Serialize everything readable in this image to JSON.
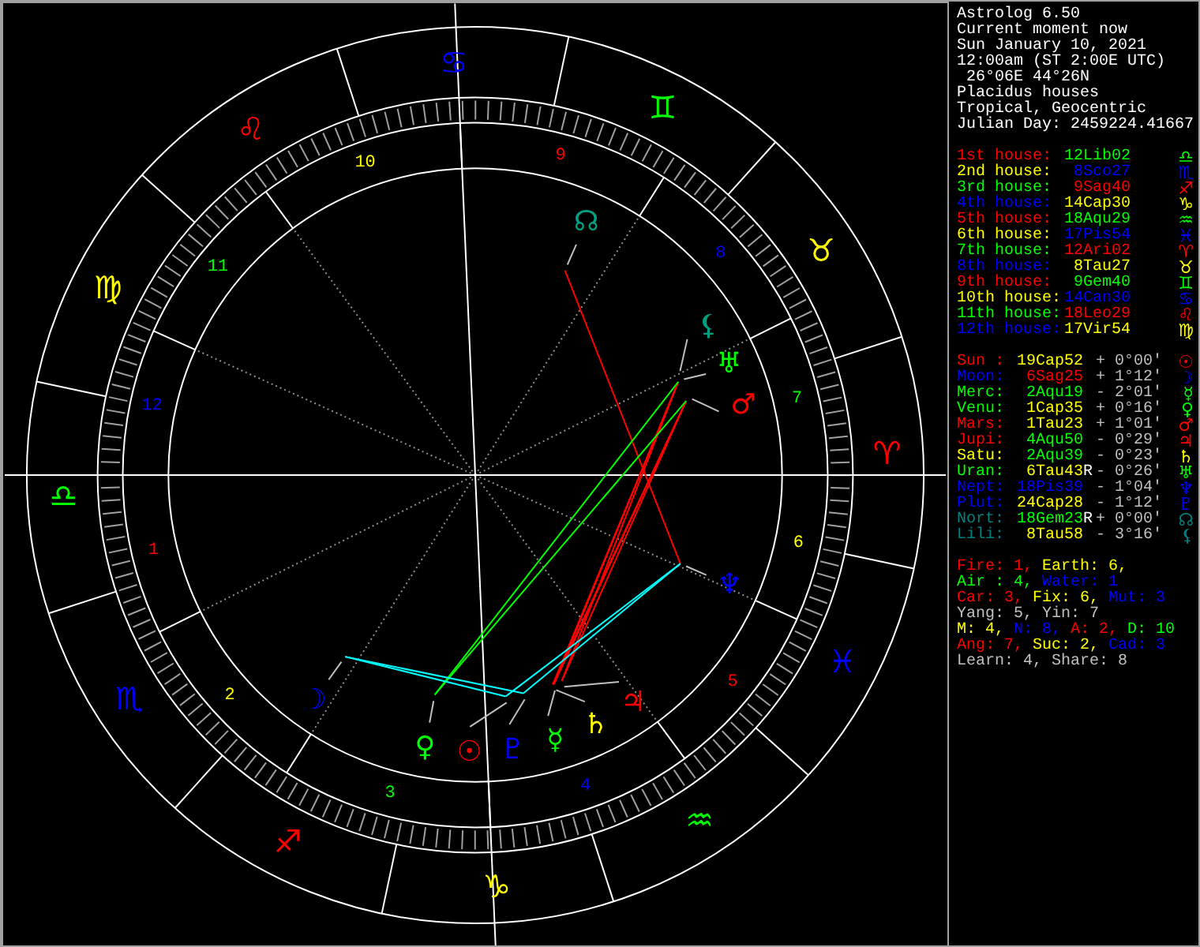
{
  "wheel": {
    "signs": [
      {
        "glyph": "♈",
        "color": "#ff0000"
      },
      {
        "glyph": "♉",
        "color": "#ffff00"
      },
      {
        "glyph": "♊",
        "color": "#00ff00"
      },
      {
        "glyph": "♋",
        "color": "#0000ff"
      },
      {
        "glyph": "♌",
        "color": "#ff0000"
      },
      {
        "glyph": "♍",
        "color": "#ffff00"
      },
      {
        "glyph": "♎",
        "color": "#00ff00"
      },
      {
        "glyph": "♏",
        "color": "#0000ff"
      },
      {
        "glyph": "♐",
        "color": "#ff0000"
      },
      {
        "glyph": "♑",
        "color": "#ffff00"
      },
      {
        "glyph": "♒",
        "color": "#00ff00"
      },
      {
        "glyph": "♓",
        "color": "#0000ff"
      }
    ],
    "houses": [
      {
        "number": "1",
        "color": "#ff0000"
      },
      {
        "number": "2",
        "color": "#ffff00"
      },
      {
        "number": "3",
        "color": "#00ff00"
      },
      {
        "number": "4",
        "color": "#0000ff"
      },
      {
        "number": "5",
        "color": "#ff0000"
      },
      {
        "number": "6",
        "color": "#ffff00"
      },
      {
        "number": "7",
        "color": "#00ff00"
      },
      {
        "number": "8",
        "color": "#0000ff"
      },
      {
        "number": "9",
        "color": "#ff0000"
      },
      {
        "number": "10",
        "color": "#ffff00"
      },
      {
        "number": "11",
        "color": "#00ff00"
      },
      {
        "number": "12",
        "color": "#0000ff"
      }
    ],
    "planets": [
      {
        "glyph": "☊",
        "color": "#00a080"
      },
      {
        "glyph": "⚸",
        "color": "#00a080"
      },
      {
        "glyph": "♅",
        "color": "#00ff00"
      },
      {
        "glyph": "♂",
        "color": "#ff0000"
      },
      {
        "glyph": "♆",
        "color": "#0000ff"
      },
      {
        "glyph": "☽",
        "color": "#0000ff"
      },
      {
        "glyph": "♃",
        "color": "#ff0000"
      },
      {
        "glyph": "♄",
        "color": "#ffff00"
      },
      {
        "glyph": "♀",
        "color": "#00ff00"
      },
      {
        "glyph": "☉",
        "color": "#ff0000"
      },
      {
        "glyph": "♇",
        "color": "#0000ff"
      },
      {
        "glyph": "☿",
        "color": "#00ff00"
      }
    ]
  },
  "info": [
    "Astrolog 6.50",
    "Current moment now",
    "Sun January 10, 2021",
    "12:00am (ST 2:00E UTC)",
    " 26°06E 44°26N",
    "Placidus houses",
    "Tropical, Geocentric",
    "Julian Day: 2459224.41667"
  ],
  "house_cusps": [
    {
      "label": {
        "text": "1st house:",
        "color": "#ff0000"
      },
      "position": {
        "text": "12Lib02",
        "color": "#00ff00"
      },
      "glyph": "♎"
    },
    {
      "label": {
        "text": "2nd house:",
        "color": "#ffff00"
      },
      "position": {
        "text": "8Sco27",
        "color": "#0000ff"
      },
      "glyph": "♏"
    },
    {
      "label": {
        "text": "3rd house:",
        "color": "#00ff00"
      },
      "position": {
        "text": "9Sag40",
        "color": "#ff0000"
      },
      "glyph": "♐"
    },
    {
      "label": {
        "text": "4th house:",
        "color": "#0000ff"
      },
      "position": {
        "text": "14Cap30",
        "color": "#ffff00"
      },
      "glyph": "♑"
    },
    {
      "label": {
        "text": "5th house:",
        "color": "#ff0000"
      },
      "position": {
        "text": "18Aqu29",
        "color": "#00ff00"
      },
      "glyph": "♒"
    },
    {
      "label": {
        "text": "6th house:",
        "color": "#ffff00"
      },
      "position": {
        "text": "17Pis54",
        "color": "#0000ff"
      },
      "glyph": "♓"
    },
    {
      "label": {
        "text": "7th house:",
        "color": "#00ff00"
      },
      "position": {
        "text": "12Ari02",
        "color": "#ff0000"
      },
      "glyph": "♈"
    },
    {
      "label": {
        "text": "8th house:",
        "color": "#0000ff"
      },
      "position": {
        "text": "8Tau27",
        "color": "#ffff00"
      },
      "glyph": "♉"
    },
    {
      "label": {
        "text": "9th house:",
        "color": "#ff0000"
      },
      "position": {
        "text": "9Gem40",
        "color": "#00ff00"
      },
      "glyph": "♊"
    },
    {
      "label": {
        "text": "10th house:",
        "color": "#ffff00"
      },
      "position": {
        "text": "14Can30",
        "color": "#0000ff"
      },
      "glyph": "♋"
    },
    {
      "label": {
        "text": "11th house:",
        "color": "#00ff00"
      },
      "position": {
        "text": "18Leo29",
        "color": "#ff0000"
      },
      "glyph": "♌"
    },
    {
      "label": {
        "text": "12th house:",
        "color": "#0000ff"
      },
      "position": {
        "text": "17Vir54",
        "color": "#ffff00"
      },
      "glyph": "♍"
    }
  ],
  "planets": [
    {
      "label": {
        "text": "Sun :",
        "color": "#ff0000"
      },
      "position": {
        "text": "19Cap52",
        "color": "#ffff00"
      },
      "retrograde": false,
      "latitude": "+ 0°00'",
      "glyph": "☉"
    },
    {
      "label": {
        "text": "Moon:",
        "color": "#0000ff"
      },
      "position": {
        "text": "6Sag25",
        "color": "#ff0000"
      },
      "retrograde": false,
      "latitude": "+ 1°12'",
      "glyph": "☽"
    },
    {
      "label": {
        "text": "Merc:",
        "color": "#00ff00"
      },
      "position": {
        "text": "2Aqu19",
        "color": "#00ff00"
      },
      "retrograde": false,
      "latitude": "- 2°01'",
      "glyph": "☿"
    },
    {
      "label": {
        "text": "Venu:",
        "color": "#00ff00"
      },
      "position": {
        "text": "1Cap35",
        "color": "#ffff00"
      },
      "retrograde": false,
      "latitude": "+ 0°16'",
      "glyph": "♀"
    },
    {
      "label": {
        "text": "Mars:",
        "color": "#ff0000"
      },
      "position": {
        "text": "1Tau23",
        "color": "#ffff00"
      },
      "retrograde": false,
      "latitude": "+ 1°01'",
      "glyph": "♂"
    },
    {
      "label": {
        "text": "Jupi:",
        "color": "#ff0000"
      },
      "position": {
        "text": "4Aqu50",
        "color": "#00ff00"
      },
      "retrograde": false,
      "latitude": "- 0°29'",
      "glyph": "♃"
    },
    {
      "label": {
        "text": "Satu:",
        "color": "#ffff00"
      },
      "position": {
        "text": "2Aqu39",
        "color": "#00ff00"
      },
      "retrograde": false,
      "latitude": "- 0°23'",
      "glyph": "♄"
    },
    {
      "label": {
        "text": "Uran:",
        "color": "#00ff00"
      },
      "position": {
        "text": "6Tau43",
        "color": "#ffff00"
      },
      "retrograde": true,
      "retrograde_mark": "R",
      "latitude": "- 0°26'",
      "glyph": "♅"
    },
    {
      "label": {
        "text": "Nept:",
        "color": "#0000ff"
      },
      "position": {
        "text": "18Pis39",
        "color": "#0000ff"
      },
      "retrograde": false,
      "latitude": "- 1°04'",
      "glyph": "♆"
    },
    {
      "label": {
        "text": "Plut:",
        "color": "#0000ff"
      },
      "position": {
        "text": "24Cap28",
        "color": "#ffff00"
      },
      "retrograde": false,
      "latitude": "- 1°12'",
      "glyph": "♇"
    },
    {
      "label": {
        "text": "Nort:",
        "color": "#008080"
      },
      "position": {
        "text": "18Gem23",
        "color": "#00ff00"
      },
      "retrograde": true,
      "retrograde_mark": "R",
      "latitude": "+ 0°00'",
      "glyph": "☊"
    },
    {
      "label": {
        "text": "Lili:",
        "color": "#008080"
      },
      "position": {
        "text": "8Tau58",
        "color": "#ffff00"
      },
      "retrograde": false,
      "latitude": "- 3°16'",
      "glyph": "⚸"
    }
  ],
  "summary": [
    [
      {
        "text": "Fire: 1,",
        "color": "#ff0000"
      },
      {
        "text": "Earth: 6,",
        "color": "#ffff00"
      }
    ],
    [
      {
        "text": "Air : 4,",
        "color": "#00ff00"
      },
      {
        "text": "Water: 1",
        "color": "#0000ff"
      }
    ],
    [
      {
        "text": "Car: 3,",
        "color": "#ff0000"
      },
      {
        "text": "Fix: 6,",
        "color": "#ffff00"
      },
      {
        "text": "Mut: 3",
        "color": "#0000ff"
      }
    ],
    [
      {
        "text": "Yang: 5, Yin: 7",
        "color": "#c0c0c0"
      }
    ],
    [
      {
        "text": "M: 4,",
        "color": "#ffff00"
      },
      {
        "text": "N: 8,",
        "color": "#0000ff"
      },
      {
        "text": "A: 2,",
        "color": "#ff0000"
      },
      {
        "text": "D: 10",
        "color": "#00ff00"
      }
    ],
    [
      {
        "text": "Ang: 7,",
        "color": "#ff0000"
      },
      {
        "text": "Suc: 2,",
        "color": "#ffff00"
      },
      {
        "text": "Cad: 3",
        "color": "#0000ff"
      }
    ],
    [
      {
        "text": "Learn: 4, Share: 8",
        "color": "#c0c0c0"
      }
    ]
  ]
}
